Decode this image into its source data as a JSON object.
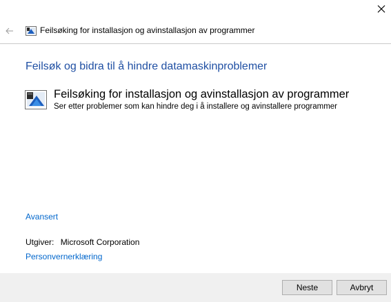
{
  "window": {
    "close_icon": "close-icon"
  },
  "header": {
    "back_icon": "back-arrow-icon",
    "app_icon": "troubleshooter-icon",
    "title": "Feilsøking for installasjon og avinstallasjon av programmer"
  },
  "main": {
    "heading": "Feilsøk og bidra til å hindre datamaskinproblemer",
    "troubleshooter": {
      "icon": "troubleshooter-icon",
      "title": "Feilsøking for installasjon og avinstallasjon av programmer",
      "description": "Ser etter problemer som kan hindre deg i å installere og avinstallere programmer"
    },
    "advanced_link": "Avansert",
    "publisher_label": "Utgiver:",
    "publisher_value": "Microsoft Corporation",
    "privacy_link": "Personvernerklæring"
  },
  "footer": {
    "next_label": "Neste",
    "cancel_label": "Avbryt"
  },
  "colors": {
    "heading": "#1f4fa3",
    "link": "#0066cc",
    "footer_bg": "#f0f0f0"
  }
}
